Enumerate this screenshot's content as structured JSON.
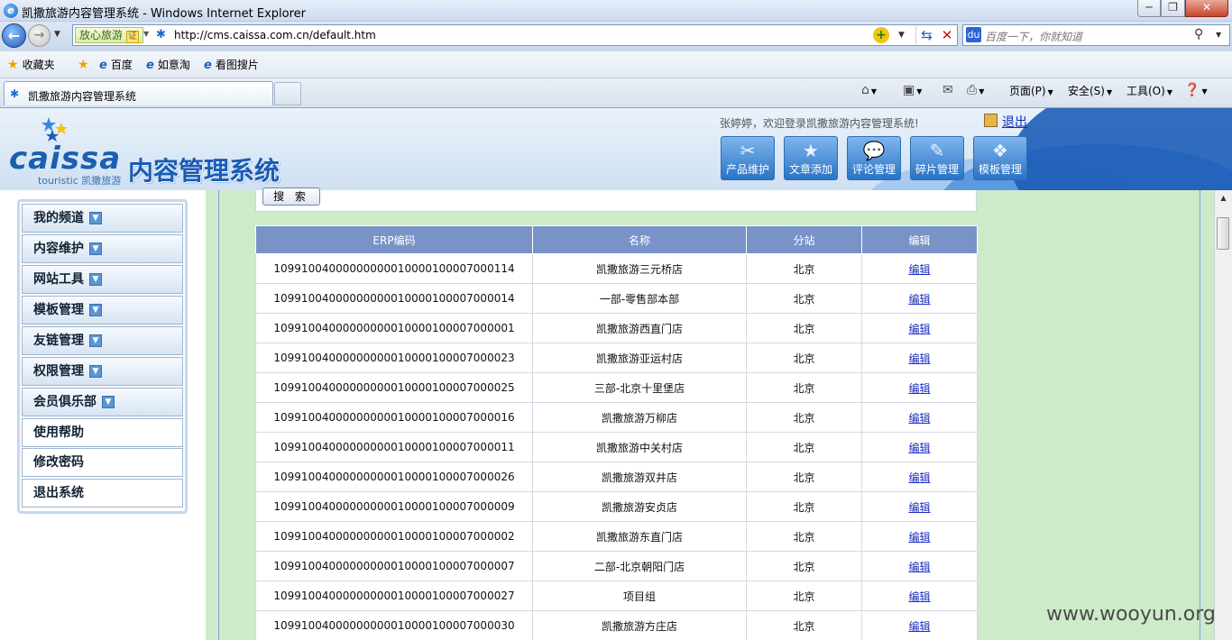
{
  "window": {
    "title": "凯撒旅游内容管理系统 - Windows Internet Explorer",
    "min_glyph": "─",
    "max_glyph": "❐",
    "close_glyph": "✕"
  },
  "addressbar": {
    "safe_label": "放心旅游 ",
    "safe_badge_mark": "证",
    "url": "http://cms.caissa.com.cn/default.htm",
    "search_placeholder": "百度一下，你就知道",
    "search_logo": "du"
  },
  "favorites": {
    "label": "收藏夹",
    "links": [
      "百度",
      "如意淘",
      "看图搜片"
    ]
  },
  "tab": {
    "label": "凯撒旅游内容管理系统"
  },
  "commandbar": {
    "page": "页面(P)",
    "safety": "安全(S)",
    "tools": "工具(O)"
  },
  "header": {
    "logo_text": "caissa",
    "logo_sub": "touristic 凯撒旅游",
    "system_title": "内容管理系统",
    "welcome": "张婷婷，欢迎登录凯撒旅游内容管理系统!",
    "logout": "退出",
    "buttons": [
      {
        "label": "产品维护",
        "icon": "wrench-icon",
        "glyph": "✂"
      },
      {
        "label": "文章添加",
        "icon": "star-icon",
        "glyph": "★"
      },
      {
        "label": "评论管理",
        "icon": "comment-icon",
        "glyph": "💬"
      },
      {
        "label": "碎片管理",
        "icon": "edit-doc-icon",
        "glyph": "✎"
      },
      {
        "label": "模板管理",
        "icon": "template-icon",
        "glyph": "❖"
      }
    ]
  },
  "sidebar": {
    "items": [
      {
        "label": "我的频道",
        "expandable": true
      },
      {
        "label": "内容维护",
        "expandable": true
      },
      {
        "label": "网站工具",
        "expandable": true
      },
      {
        "label": "模板管理",
        "expandable": true
      },
      {
        "label": "友链管理",
        "expandable": true
      },
      {
        "label": "权限管理",
        "expandable": true
      },
      {
        "label": "会员俱乐部",
        "expandable": true
      },
      {
        "label": "使用帮助",
        "expandable": false
      },
      {
        "label": "修改密码",
        "expandable": false
      },
      {
        "label": "退出系统",
        "expandable": false
      }
    ]
  },
  "search": {
    "button": "搜 索"
  },
  "table": {
    "headers": [
      "ERP编码",
      "名称",
      "分站",
      "编辑"
    ],
    "rows": [
      [
        "10991004000000000010000100007000114",
        "凯撒旅游三元桥店",
        "北京",
        "编辑"
      ],
      [
        "10991004000000000010000100007000014",
        "一部-零售部本部",
        "北京",
        "编辑"
      ],
      [
        "10991004000000000010000100007000001",
        "凯撒旅游西直门店",
        "北京",
        "编辑"
      ],
      [
        "10991004000000000010000100007000023",
        "凯撒旅游亚运村店",
        "北京",
        "编辑"
      ],
      [
        "10991004000000000010000100007000025",
        "三部-北京十里堡店",
        "北京",
        "编辑"
      ],
      [
        "10991004000000000010000100007000016",
        "凯撒旅游万柳店",
        "北京",
        "编辑"
      ],
      [
        "10991004000000000010000100007000011",
        "凯撒旅游中关村店",
        "北京",
        "编辑"
      ],
      [
        "10991004000000000010000100007000026",
        "凯撒旅游双井店",
        "北京",
        "编辑"
      ],
      [
        "10991004000000000010000100007000009",
        "凯撒旅游安贞店",
        "北京",
        "编辑"
      ],
      [
        "10991004000000000010000100007000002",
        "凯撒旅游东直门店",
        "北京",
        "编辑"
      ],
      [
        "10991004000000000010000100007000007",
        "二部-北京朝阳门店",
        "北京",
        "编辑"
      ],
      [
        "10991004000000000010000100007000027",
        "项目组",
        "北京",
        "编辑"
      ],
      [
        "10991004000000000010000100007000030",
        "凯撒旅游方庄店",
        "北京",
        "编辑"
      ]
    ]
  },
  "watermark": "www.wooyun.org"
}
